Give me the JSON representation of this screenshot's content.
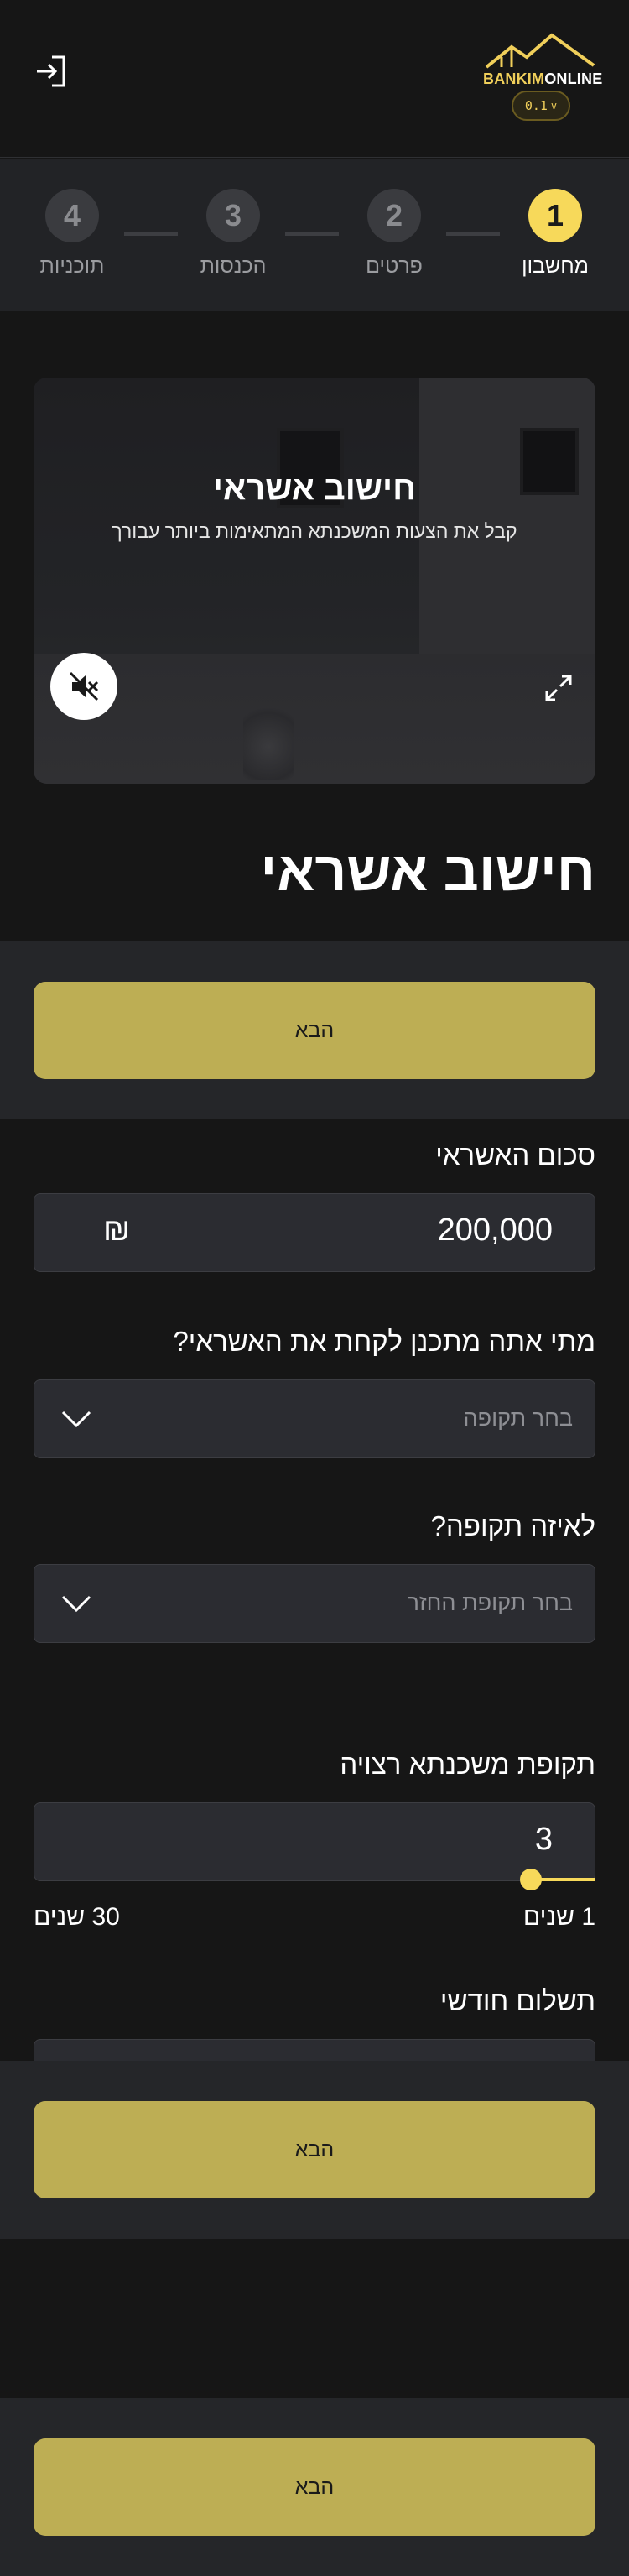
{
  "header": {
    "logo_part1": "BANKIM",
    "logo_part2": "ONLINE",
    "version": "0.1",
    "version_chevron": "v",
    "accent_color": "#f7d95a"
  },
  "stepper": {
    "steps": [
      {
        "number": "1",
        "label": "מחשבון",
        "active": true
      },
      {
        "number": "2",
        "label": "פרטים",
        "active": false
      },
      {
        "number": "3",
        "label": "הכנסות",
        "active": false
      },
      {
        "number": "4",
        "label": "תוכניות",
        "active": false
      }
    ]
  },
  "video": {
    "title": "חישוב אשראי",
    "subtitle": "קבל את הצעות המשכנתא המתאימות ביותר עבורך",
    "mute_icon": "speaker-muted-icon",
    "expand_icon": "expand-icon"
  },
  "page": {
    "title": "חישוב אשראי"
  },
  "buttons": {
    "next_label": "הבא"
  },
  "form": {
    "credit_amount": {
      "label": "סכום האשראי",
      "value": "200,000",
      "currency": "₪"
    },
    "when_take_credit": {
      "label": "מתי אתה מתכנן לקחת את האשראי?",
      "placeholder": "בחר תקופה"
    },
    "which_period": {
      "label": "לאיזה תקופה?",
      "placeholder": "בחר תקופת החזר"
    },
    "desired_period": {
      "label": "תקופת משכנתא רצויה",
      "value": "3",
      "min_label": "1 שנים",
      "max_label": "30 שנים",
      "slider_fraction": 0.07
    },
    "monthly_payment": {
      "label": "תשלום חודשי"
    }
  }
}
